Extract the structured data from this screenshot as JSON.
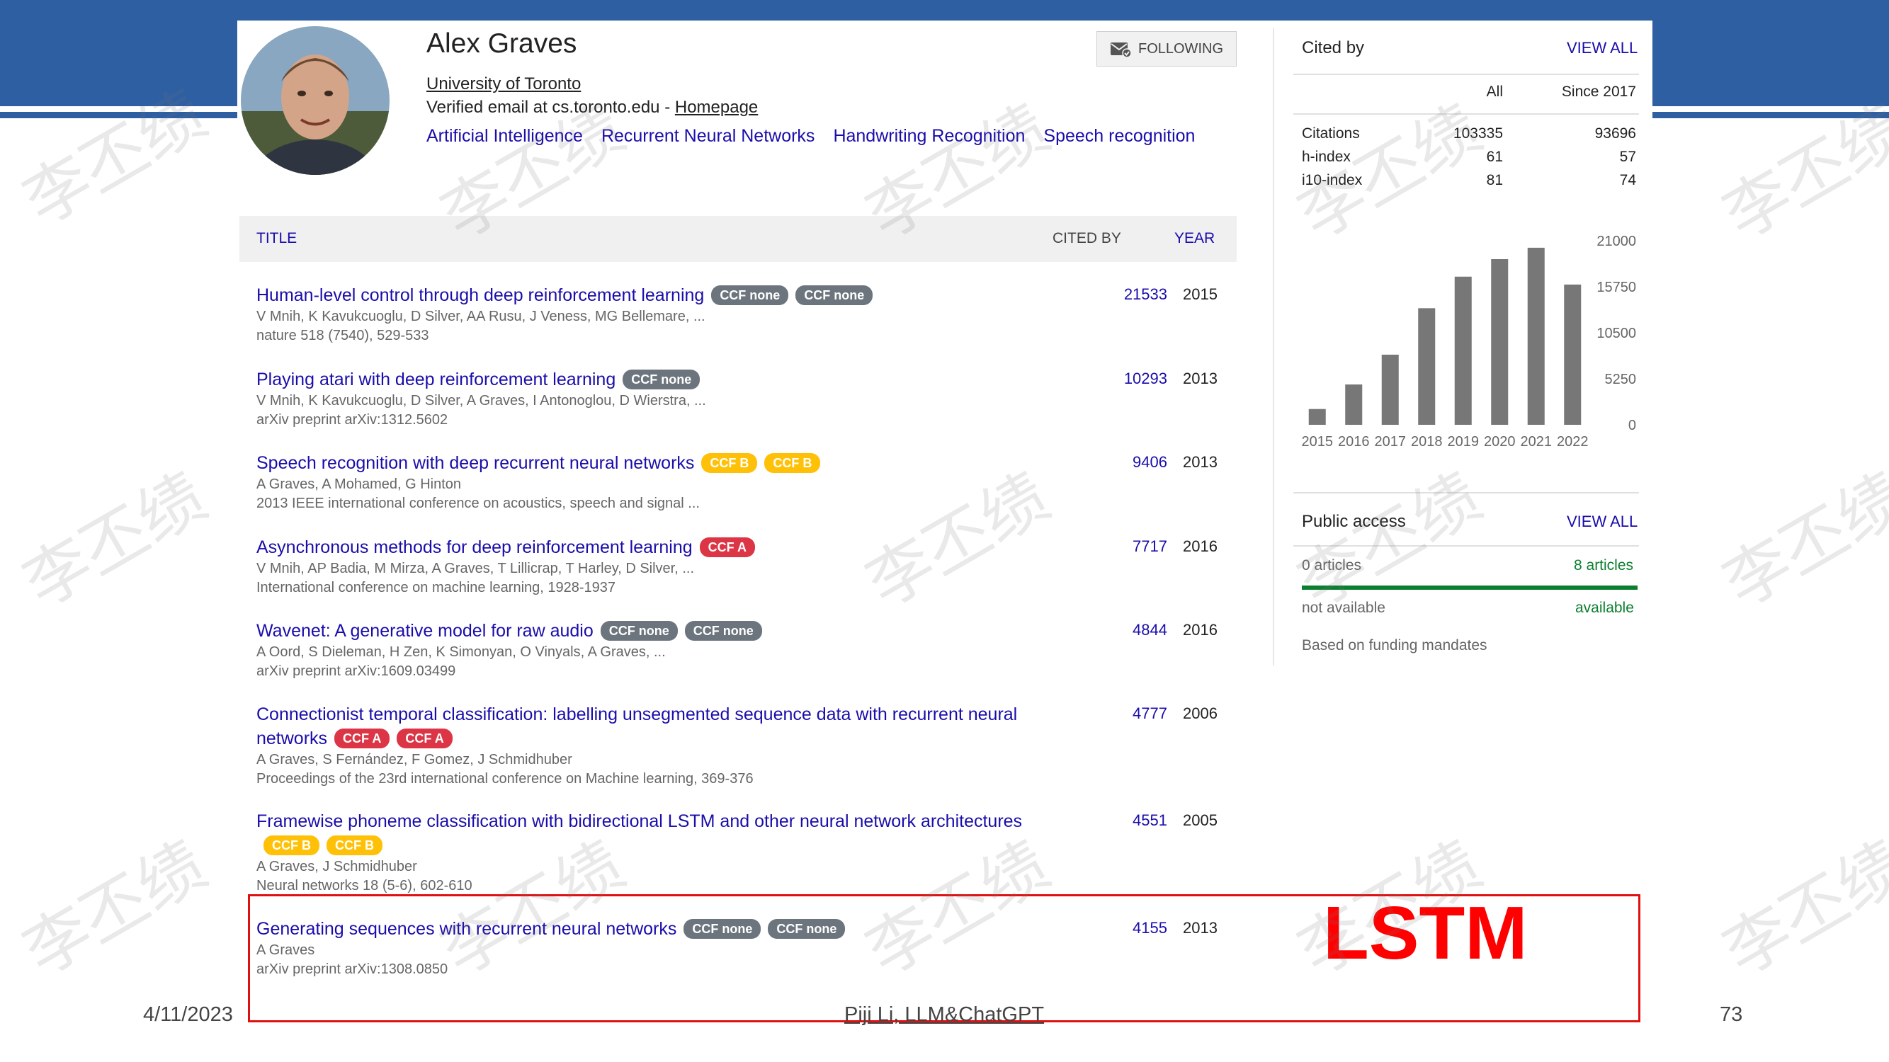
{
  "profile": {
    "name": "Alex Graves",
    "affiliation": "University of Toronto",
    "email_text": "Verified email at cs.toronto.edu - ",
    "homepage_label": "Homepage",
    "interests": [
      "Artificial Intelligence",
      "Recurrent Neural Networks",
      "Handwriting Recognition",
      "Speech recognition"
    ],
    "follow_label": "FOLLOWING"
  },
  "table_header": {
    "title": "TITLE",
    "cited_by": "CITED BY",
    "year": "YEAR"
  },
  "papers": [
    {
      "title": "Human-level control through deep reinforcement learning",
      "badges": [
        "CCF none",
        "CCF none"
      ],
      "authors": "V Mnih, K Kavukcuoglu, D Silver, AA Rusu, J Veness, MG Bellemare, ...",
      "venue": "nature 518 (7540), 529-533",
      "cited": "21533",
      "year": "2015"
    },
    {
      "title": "Playing atari with deep reinforcement learning",
      "badges": [
        "CCF none"
      ],
      "authors": "V Mnih, K Kavukcuoglu, D Silver, A Graves, I Antonoglou, D Wierstra, ...",
      "venue": "arXiv preprint arXiv:1312.5602",
      "cited": "10293",
      "year": "2013"
    },
    {
      "title": "Speech recognition with deep recurrent neural networks",
      "badges": [
        "CCF B",
        "CCF B"
      ],
      "authors": "A Graves, A Mohamed, G Hinton",
      "venue": "2013 IEEE international conference on acoustics, speech and signal ...",
      "cited": "9406",
      "year": "2013"
    },
    {
      "title": "Asynchronous methods for deep reinforcement learning",
      "badges": [
        "CCF A"
      ],
      "authors": "V Mnih, AP Badia, M Mirza, A Graves, T Lillicrap, T Harley, D Silver, ...",
      "venue": "International conference on machine learning, 1928-1937",
      "cited": "7717",
      "year": "2016"
    },
    {
      "title": "Wavenet: A generative model for raw audio",
      "badges": [
        "CCF none",
        "CCF none"
      ],
      "authors": "A Oord, S Dieleman, H Zen, K Simonyan, O Vinyals, A Graves, ...",
      "venue": "arXiv preprint arXiv:1609.03499",
      "cited": "4844",
      "year": "2016"
    },
    {
      "title": "Connectionist temporal classification: labelling unsegmented sequence data with recurrent neural networks",
      "badges": [
        "CCF A",
        "CCF A"
      ],
      "authors": "A Graves, S Fernández, F Gomez, J Schmidhuber",
      "venue": "Proceedings of the 23rd international conference on Machine learning, 369-376",
      "cited": "4777",
      "year": "2006"
    },
    {
      "title": "Framewise phoneme classification with bidirectional LSTM and other neural network architectures",
      "badges": [
        "CCF B",
        "CCF B"
      ],
      "authors": "A Graves, J Schmidhuber",
      "venue": "Neural networks 18 (5-6), 602-610",
      "cited": "4551",
      "year": "2005"
    },
    {
      "title": "Generating sequences with recurrent neural networks",
      "badges": [
        "CCF none",
        "CCF none"
      ],
      "authors": "A Graves",
      "venue": "arXiv preprint arXiv:1308.0850",
      "cited": "4155",
      "year": "2013"
    }
  ],
  "cited_by": {
    "title": "Cited by",
    "view_all": "VIEW ALL",
    "col_all": "All",
    "col_since": "Since 2017",
    "rows": [
      {
        "label": "Citations",
        "all": "103335",
        "since": "93696"
      },
      {
        "label": "h-index",
        "all": "61",
        "since": "57"
      },
      {
        "label": "i10-index",
        "all": "81",
        "since": "74"
      }
    ]
  },
  "chart_data": {
    "type": "bar",
    "categories": [
      "2015",
      "2016",
      "2017",
      "2018",
      "2019",
      "2020",
      "2021",
      "2022"
    ],
    "values": [
      1800,
      4600,
      8000,
      13300,
      16900,
      18900,
      20200,
      16000
    ],
    "ylim": [
      0,
      21000
    ],
    "yticks": [
      "21000",
      "15750",
      "10500",
      "5250",
      "0"
    ],
    "ytick_values": [
      21000,
      15750,
      10500,
      5250,
      0
    ],
    "bar_color": "#777777"
  },
  "public_access": {
    "title": "Public access",
    "view_all": "VIEW ALL",
    "left_count": "0 articles",
    "right_count": "8 articles",
    "left_status": "not available",
    "right_status": "available",
    "note": "Based on funding mandates"
  },
  "slide": {
    "annotation": "LSTM",
    "date": "4/11/2023",
    "footer": "Piji Li, LLM&ChatGPT",
    "page": "73",
    "watermark": "李丕绩"
  }
}
